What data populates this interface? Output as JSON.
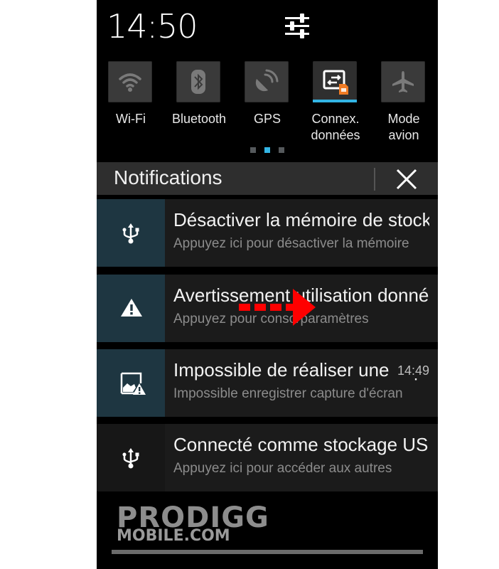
{
  "status": {
    "time": "14:50"
  },
  "quick_settings": {
    "tiles": [
      {
        "label": "Wi-Fi",
        "icon": "wifi-icon",
        "active": false
      },
      {
        "label": "Bluetooth",
        "icon": "bluetooth-icon",
        "active": false
      },
      {
        "label": "GPS",
        "icon": "gps-icon",
        "active": false
      },
      {
        "label": "Connex. données",
        "icon": "data-connection-icon",
        "active": true
      },
      {
        "label": "Mode avion",
        "icon": "airplane-icon",
        "active": false
      }
    ],
    "tile_labels": {
      "wifi": "Wi-Fi",
      "bluetooth": "Bluetooth",
      "gps": "GPS",
      "data_line1": "Connex.",
      "data_line2": "données",
      "airplane_line1": "Mode",
      "airplane_line2": "avion"
    },
    "page_indicator": {
      "pages": 3,
      "current": 2
    },
    "active_color": "#33b5e5",
    "sim_badge_color": "#f07b24"
  },
  "notifications": {
    "header_title": "Notifications",
    "items": [
      {
        "icon": "usb-icon",
        "title": "Désactiver la mémoire de stockage USB",
        "subtitle": "Appuyez ici pour désactiver la mémoire",
        "time": ""
      },
      {
        "icon": "warning-icon",
        "title": "Avertissement utilisation données",
        "subtitle": "Appuyez pour conso/paramètres",
        "time": ""
      },
      {
        "icon": "screenshot-error-icon",
        "title": "Impossible de réaliser une capture",
        "subtitle": "Impossible enregistrer capture d'écran",
        "time": "14:49"
      },
      {
        "icon": "usb-icon",
        "title": "Connecté comme stockage USB",
        "subtitle": "Appuyez ici pour accéder aux autres",
        "time": ""
      }
    ],
    "icon_bg_color": "#1e3641"
  },
  "annotation": {
    "arrow_color": "#ff0000"
  },
  "watermark": {
    "line1": "PRODIGG",
    "line2": "MOBILE.COM"
  }
}
